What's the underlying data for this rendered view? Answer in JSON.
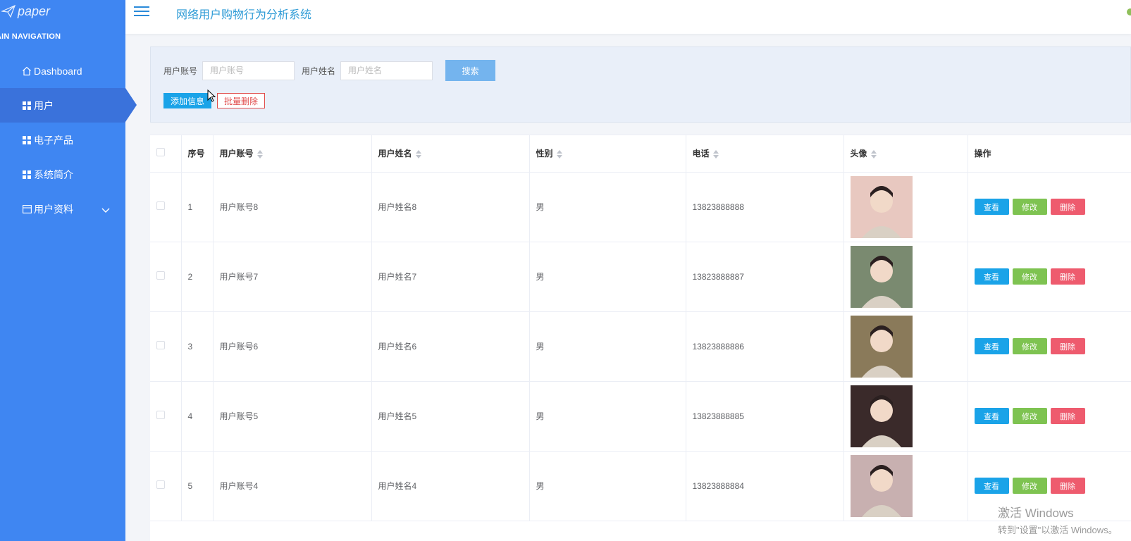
{
  "sidebar": {
    "logo_text": "paper",
    "nav_header": "AIN NAVIGATION",
    "items": [
      {
        "label": "Dashboard",
        "icon": "home-icon"
      },
      {
        "label": "用户",
        "icon": "grid-icon"
      },
      {
        "label": "电子产品",
        "icon": "grid-icon"
      },
      {
        "label": "系统简介",
        "icon": "grid-icon"
      },
      {
        "label": "用户资料",
        "icon": "calendar-icon"
      }
    ]
  },
  "header": {
    "title": "网络用户购物行为分析系统"
  },
  "search": {
    "account_label": "用户账号",
    "account_placeholder": "用户账号",
    "name_label": "用户姓名",
    "name_placeholder": "用户姓名",
    "search_button": "搜索",
    "add_button": "添加信息",
    "batch_delete_button": "批量删除"
  },
  "table": {
    "headers": [
      "序号",
      "用户账号",
      "用户姓名",
      "性别",
      "电话",
      "头像",
      "操作"
    ],
    "rows": [
      {
        "index": "1",
        "account": "用户账号8",
        "name": "用户姓名8",
        "gender": "男",
        "phone": "13823888888",
        "avatar_color": "#e8c8c0"
      },
      {
        "index": "2",
        "account": "用户账号7",
        "name": "用户姓名7",
        "gender": "男",
        "phone": "13823888887",
        "avatar_color": "#7a8a70"
      },
      {
        "index": "3",
        "account": "用户账号6",
        "name": "用户姓名6",
        "gender": "男",
        "phone": "13823888886",
        "avatar_color": "#8a7a5a"
      },
      {
        "index": "4",
        "account": "用户账号5",
        "name": "用户姓名5",
        "gender": "男",
        "phone": "13823888885",
        "avatar_color": "#3a2a2a"
      },
      {
        "index": "5",
        "account": "用户账号4",
        "name": "用户姓名4",
        "gender": "男",
        "phone": "13823888884",
        "avatar_color": "#c8b0b0"
      }
    ],
    "actions": {
      "view": "查看",
      "edit": "修改",
      "delete": "删除"
    }
  },
  "watermark": {
    "line1": "激活 Windows",
    "line2": "转到\"设置\"以激活 Windows。"
  }
}
